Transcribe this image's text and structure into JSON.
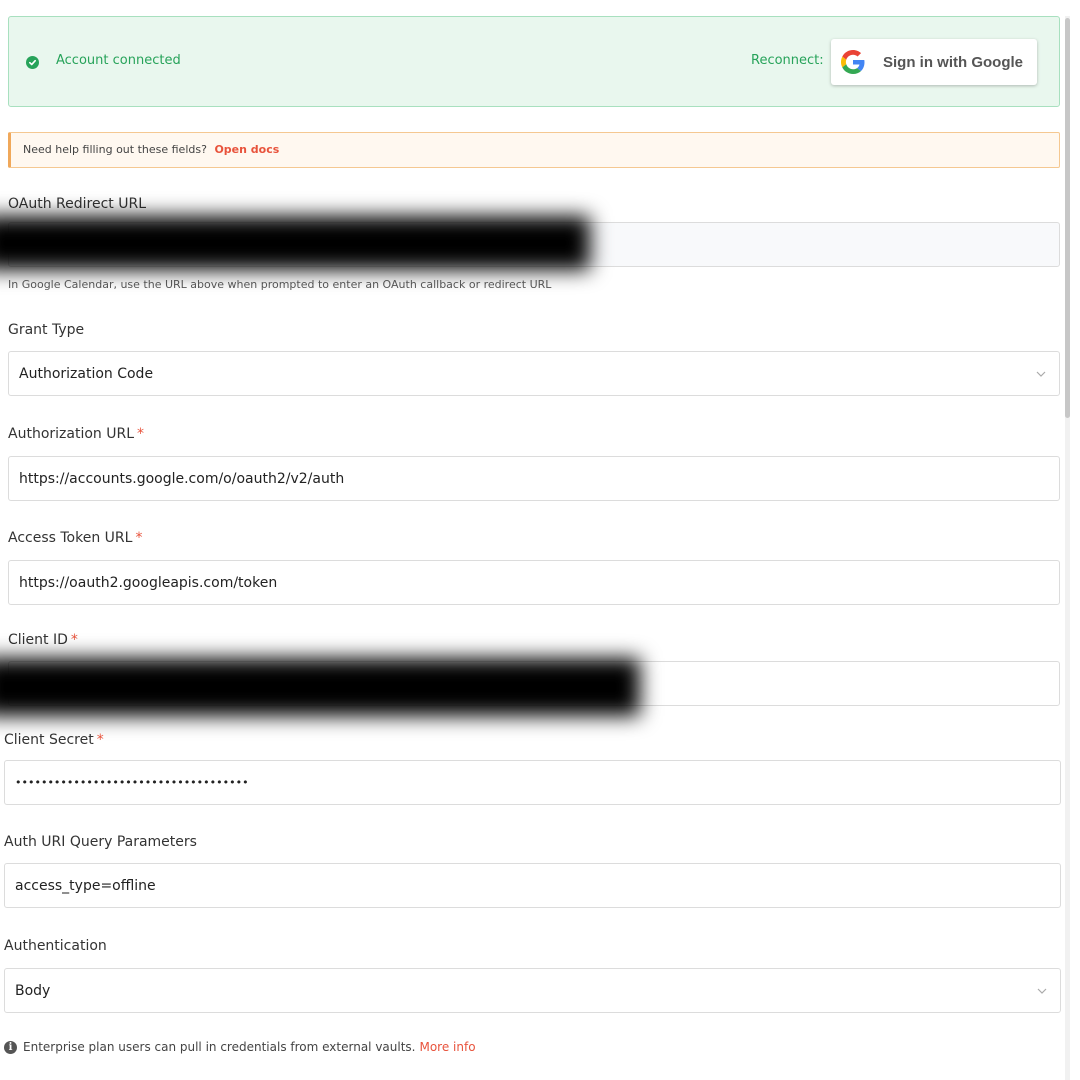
{
  "banner": {
    "status": "Account connected",
    "reconnect_label": "Reconnect:",
    "google_button_label": "Sign in with Google"
  },
  "help": {
    "text": "Need help filling out these fields?",
    "link": "Open docs"
  },
  "fields": {
    "redirect_url": {
      "label": "OAuth Redirect URL",
      "value": "",
      "hint": "In Google Calendar, use the URL above when prompted to enter an OAuth callback or redirect URL"
    },
    "grant_type": {
      "label": "Grant Type",
      "value": "Authorization Code"
    },
    "auth_url": {
      "label": "Authorization URL",
      "required": "*",
      "value": "https://accounts.google.com/o/oauth2/v2/auth"
    },
    "token_url": {
      "label": "Access Token URL",
      "required": "*",
      "value": "https://oauth2.googleapis.com/token"
    },
    "client_id": {
      "label": "Client ID",
      "required": "*",
      "value": ""
    },
    "client_secret": {
      "label": "Client Secret",
      "required": "*",
      "value": "••••••••••••••••••••••••••••••••••••"
    },
    "auth_params": {
      "label": "Auth URI Query Parameters",
      "value": "access_type=offline"
    },
    "authentication": {
      "label": "Authentication",
      "value": "Body"
    }
  },
  "footer": {
    "text": "Enterprise plan users can pull in credentials from external vaults.",
    "link": "More info"
  },
  "colors": {
    "success": "#27a35a",
    "accent": "#e8533c",
    "required": "#e8533c"
  }
}
